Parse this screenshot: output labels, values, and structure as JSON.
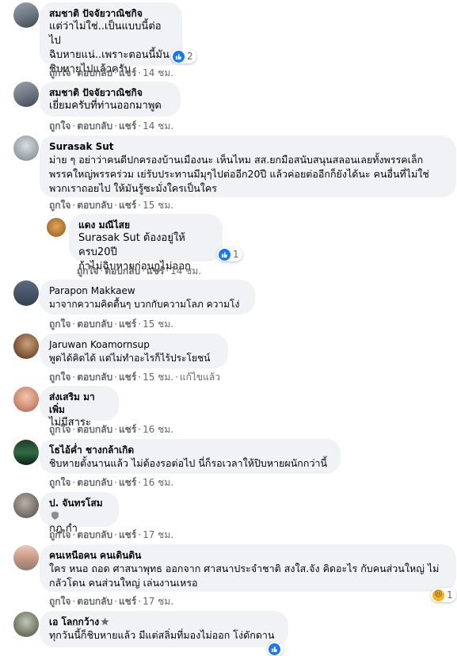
{
  "actions": {
    "like": "ถูกใจ",
    "reply": "ตอบกลับ",
    "share": "แชร์",
    "edited": "แก้ไขแล้ว",
    "sep": "·"
  },
  "comments": [
    {
      "name": "สมชาติ ปัจจัยวาณิชกิจ",
      "text": "แต่ว่าไม่ใช่..เป็นแบบนี้ต่อไป\nฉิบหายแน่..เพราะตอนนี้มัน\nชิบหายไปแล้วครับ",
      "time": "14 ชม.",
      "reaction": "like",
      "reaction_count": "2"
    },
    {
      "name": "สมชาติ ปัจจัยวาณิชกิจ",
      "text": "เยี่ยมครับที่ท่านออกมาพูด",
      "time": "14 ชม."
    },
    {
      "name": "Surasak Sut",
      "text": "ม่าย ๆ อย่าว่าคนดีปกครองบ้านเมืองนะ เห็นไหม สส.ยกมือสนับสนุนสลอนเลยทั้งพรรคเล็ก\nพรรคใหญ่พรรคร่วม เย่รับประทานมีมุๆไปต่ออีก20ปี แล้วค่อยต่ออีกก็ยังได้นะ คนอื่นที่ไม่ใช่\nพวกเราถอยไป ให้มันรู้ซะมั่งใครเป็นใคร",
      "time": "15 ชม."
    },
    {
      "name": "แดง มณีไสย",
      "text": "Surasak Sut ต้องอยู่ให้ครบ20ปี\nถ้าไม่ฉิบหายก่อนกูไม่ออก",
      "time": "14 ชม.",
      "reaction": "like",
      "reaction_count": "1"
    },
    {
      "name": "Parapon Makkaew",
      "text": "มาจากความคิดตื้นๆ บวกกับความโลภ ความโง่",
      "time": "15 ชม."
    },
    {
      "name": "Jaruwan Koamornsup",
      "text": "พูดได้คิดได้ แต่ไม่ทำอะไรก็ไร้ประโยชน์",
      "time": "15 ชม."
    },
    {
      "name": "ส่งเสริม มาเพิ่ม",
      "text": "ไม่มีสาระ",
      "time": "16 ชม."
    },
    {
      "name": "โธไอ้ค่ำ ชางกล้าเกิด",
      "text": "ชิบหายตั้งนานแล้ว ไม่ต้องรอต่อไป นี่ก็รอเวลาให้ปิบหายผนักกว่านี้",
      "time": "16 ชม."
    },
    {
      "name": "ป. จันทรโสม",
      "text": "กฎ กำ",
      "time": "17 ชม."
    },
    {
      "name": "คนเหนือคน คนเดินดิน",
      "text": "ใคร หนอ ถอด ศาสนาพุทธ ออกจาก ศาสนาประจำชาติ สงใส.จัง คิดอะไร กับคนส่วนใหญ่ ไม่\nกลัวโดน คนส่วนใหญ่ เล่นงานเหรอ",
      "time": "17 ชม.",
      "reaction": "haha",
      "reaction_count": "1"
    },
    {
      "name": "เอ โลกกว้าง",
      "text": "ทุกวันนี้ก็ชิบหายแล้ว มีแต่สลิ่มที่มองไม่ออก โง่ดักดาน",
      "time": ""
    }
  ],
  "colors": {
    "bubble": "#f0f2f5",
    "meta": "#65676b",
    "like": "#1877f2",
    "haha": "#f7b125"
  }
}
